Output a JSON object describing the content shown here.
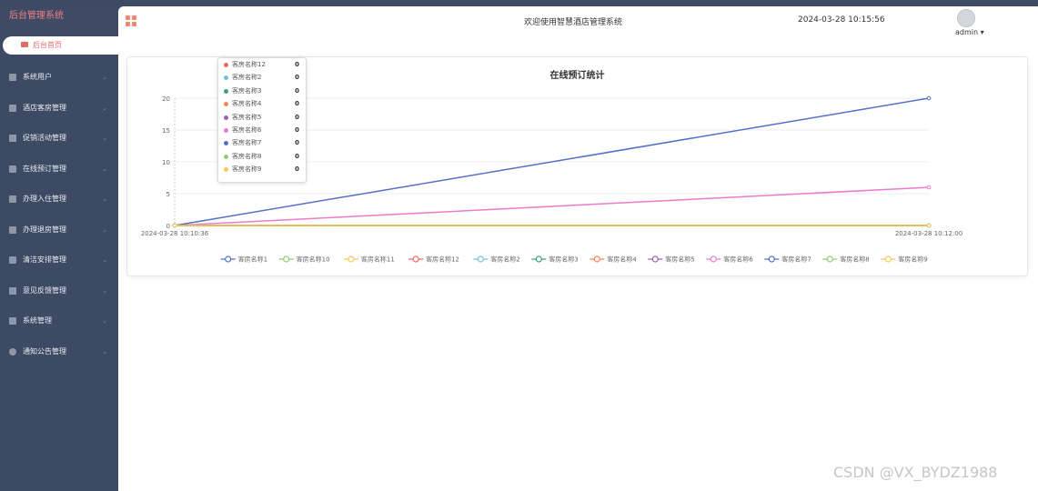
{
  "app": {
    "title": "后台管理系统",
    "home_tab": "后台首页"
  },
  "sidebar": {
    "items": [
      {
        "label": "系统用户",
        "icon": "user-icon"
      },
      {
        "label": "酒店客房管理",
        "icon": "table-icon"
      },
      {
        "label": "促销活动管理",
        "icon": "table-icon"
      },
      {
        "label": "在线预订管理",
        "icon": "table-icon"
      },
      {
        "label": "办理入住管理",
        "icon": "table-icon"
      },
      {
        "label": "办理退房管理",
        "icon": "table-icon"
      },
      {
        "label": "清洁安排管理",
        "icon": "table-icon"
      },
      {
        "label": "意见反馈管理",
        "icon": "table-icon"
      },
      {
        "label": "系统管理",
        "icon": "bar-chart-icon"
      },
      {
        "label": "通知公告管理",
        "icon": "info-icon"
      }
    ]
  },
  "header": {
    "welcome": "欢迎使用智慧酒店管理系统",
    "datetime": "2024-03-28 10:15:56",
    "username": "admin"
  },
  "chart_data": {
    "type": "line",
    "title": "在线预订统计",
    "x": [
      "2024-03-28 10:10:36",
      "2024-03-28 10:12:00"
    ],
    "ylim": [
      0,
      20
    ],
    "yticks": [
      0,
      5,
      10,
      15,
      20
    ],
    "grid": true,
    "legend_position": "bottom",
    "series": [
      {
        "name": "客房名称1",
        "color": "#5470c6",
        "values": [
          0,
          0
        ]
      },
      {
        "name": "客房名称10",
        "color": "#91cc75",
        "values": [
          0,
          0
        ]
      },
      {
        "name": "客房名称11",
        "color": "#fac858",
        "values": [
          0,
          0
        ]
      },
      {
        "name": "客房名称12",
        "color": "#ee6666",
        "values": [
          0,
          0
        ]
      },
      {
        "name": "客房名称2",
        "color": "#73c0de",
        "values": [
          0,
          0
        ]
      },
      {
        "name": "客房名称3",
        "color": "#3ba272",
        "values": [
          0,
          0
        ]
      },
      {
        "name": "客房名称4",
        "color": "#fc8452",
        "values": [
          0,
          0
        ]
      },
      {
        "name": "客房名称5",
        "color": "#9a60b4",
        "values": [
          0,
          0
        ]
      },
      {
        "name": "客房名称6",
        "color": "#ea7ccc",
        "values": [
          0,
          6
        ]
      },
      {
        "name": "客房名称7",
        "color": "#5470c6",
        "values": [
          0,
          20
        ]
      },
      {
        "name": "客房名称8",
        "color": "#91cc75",
        "values": [
          0,
          0
        ]
      },
      {
        "name": "客房名称9",
        "color": "#fac858",
        "values": [
          0,
          0
        ]
      }
    ]
  },
  "tooltip": {
    "rows": [
      {
        "name": "客房名称12",
        "value": "0",
        "color": "#ee6666"
      },
      {
        "name": "客房名称2",
        "value": "0",
        "color": "#73c0de"
      },
      {
        "name": "客房名称3",
        "value": "0",
        "color": "#3ba272"
      },
      {
        "name": "客房名称4",
        "value": "0",
        "color": "#fc8452"
      },
      {
        "name": "客房名称5",
        "value": "0",
        "color": "#9a60b4"
      },
      {
        "name": "客房名称6",
        "value": "0",
        "color": "#ea7ccc"
      },
      {
        "name": "客房名称7",
        "value": "0",
        "color": "#5470c6"
      },
      {
        "name": "客房名称8",
        "value": "0",
        "color": "#91cc75"
      },
      {
        "name": "客房名称9",
        "value": "0",
        "color": "#fac858"
      }
    ]
  },
  "watermark": "CSDN @VX_BYDZ1988"
}
